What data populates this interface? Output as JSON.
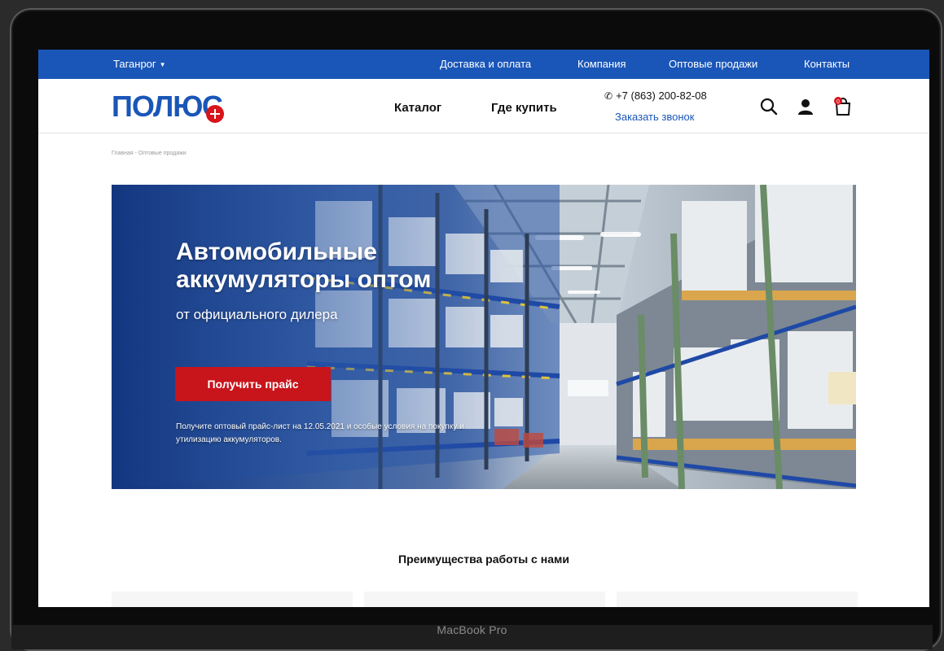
{
  "topbar": {
    "city": "Таганрог",
    "links": [
      "Доставка и оплата",
      "Компания",
      "Оптовые продажи",
      "Контакты"
    ]
  },
  "header": {
    "logo_text": "ПОЛЮС",
    "nav": [
      "Каталог",
      "Где купить"
    ],
    "phone": "+7 (863) 200-82-08",
    "callback": "Заказать звонок",
    "cart_count": "0"
  },
  "breadcrumb": "Главная - Оптовые продажи",
  "hero": {
    "title": "Автомобильные аккумуляторы оптом",
    "subtitle": "от официального дилера",
    "button": "Получить прайс",
    "note": "Получите оптовый прайс-лист на 12.05.2021 и особые условия на покупку и утилизацию аккумуляторов."
  },
  "advantages_title": "Преимущества работы с нами",
  "device_label": "MacBook Pro",
  "colors": {
    "brand_blue": "#1a56b8",
    "accent_red": "#c8141b"
  }
}
